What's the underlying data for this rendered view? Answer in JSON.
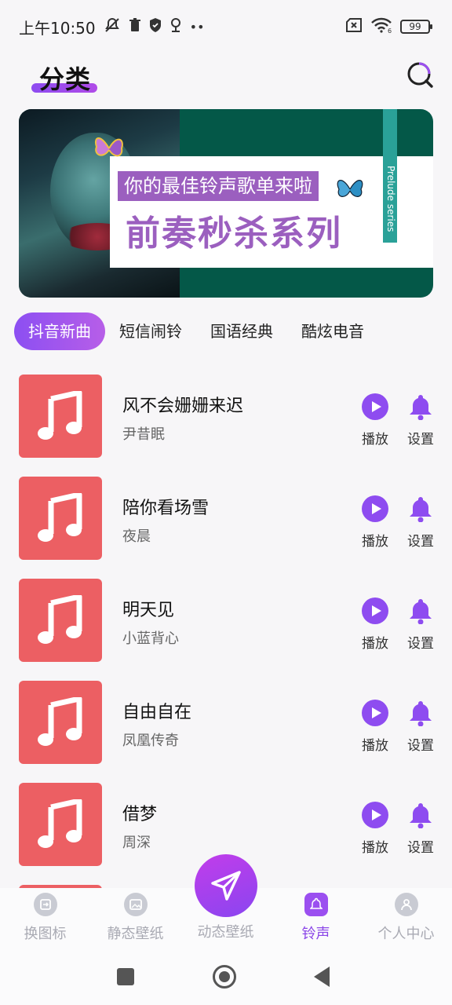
{
  "status_bar": {
    "time": "上午10:50",
    "battery": "99",
    "network_badge": "6"
  },
  "header": {
    "title": "分类",
    "search_icon": "search-icon"
  },
  "banner": {
    "tag_text": "你的最佳铃声歌单来啦",
    "main_text": "前奏秒杀系列",
    "vertical_text": "Prelude series"
  },
  "tabs": [
    {
      "label": "抖音新曲",
      "active": true
    },
    {
      "label": "短信闹铃",
      "active": false
    },
    {
      "label": "国语经典",
      "active": false
    },
    {
      "label": "酷炫电音",
      "active": false
    }
  ],
  "songs": [
    {
      "title": "风不会姗姗来迟",
      "artist": "尹昔眠"
    },
    {
      "title": "陪你看场雪",
      "artist": "夜晨"
    },
    {
      "title": "明天见",
      "artist": "小蓝背心"
    },
    {
      "title": "自由自在",
      "artist": "凤凰传奇"
    },
    {
      "title": "借梦",
      "artist": "周深"
    }
  ],
  "actions": {
    "play_label": "播放",
    "set_label": "设置"
  },
  "bottom_nav": [
    {
      "label": "换图标",
      "icon": "icon-swap-icon",
      "active": false
    },
    {
      "label": "静态壁纸",
      "icon": "image-icon",
      "active": false
    },
    {
      "label": "动态壁纸",
      "icon": "paper-plane-icon",
      "active": false
    },
    {
      "label": "铃声",
      "icon": "bell-icon",
      "active": true
    },
    {
      "label": "个人中心",
      "icon": "user-icon",
      "active": false
    }
  ],
  "colors": {
    "accent": "#8e4cf0",
    "cover": "#ec5f63",
    "banner_purple": "#9b5fbf",
    "banner_green": "#045848"
  }
}
